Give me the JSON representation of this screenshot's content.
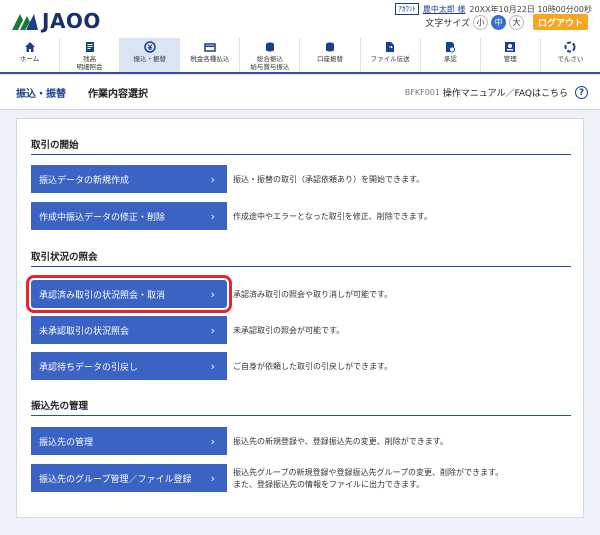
{
  "header": {
    "logo_text": "JAOO",
    "user_badge": "ｱｶｳﾝﾄ",
    "user_name": "農中太郎 様",
    "last_login": "20XX年10月22日 10時00分00秒",
    "font_size_label": "文字サイズ",
    "font_sizes": [
      "小",
      "中",
      "大"
    ],
    "logout": "ログアウト"
  },
  "nav": {
    "items": [
      {
        "label": "ホーム",
        "icon": "home-icon"
      },
      {
        "label": "残高\n明細照会",
        "icon": "document-icon"
      },
      {
        "label": "振込・振替",
        "icon": "yen-transfer-icon"
      },
      {
        "label": "税金各種払込",
        "icon": "tax-payment-icon"
      },
      {
        "label": "総合振込\n給与賞与振込",
        "icon": "coin-stack-icon"
      },
      {
        "label": "口座振替",
        "icon": "coin-stack-icon"
      },
      {
        "label": "ファイル伝送",
        "icon": "file-transfer-icon"
      },
      {
        "label": "承認",
        "icon": "approve-icon"
      },
      {
        "label": "管理",
        "icon": "admin-icon"
      },
      {
        "label": "でんさい",
        "icon": "densai-icon"
      }
    ]
  },
  "page": {
    "category": "振込・振替",
    "title": "作業内容選択",
    "code": "BFKF001",
    "help": "操作マニュアル／FAQはこちら",
    "help_icon": "?"
  },
  "sections": {
    "start": {
      "title": "取引の開始",
      "actions": [
        {
          "label": "振込データの新規作成",
          "desc": "振込・振替の取引（承認依頼あり）を開始できます。"
        },
        {
          "label": "作成中振込データの修正・削除",
          "desc": "作成途中やエラーとなった取引を修正、削除できます。"
        }
      ]
    },
    "status": {
      "title": "取引状況の照会",
      "actions": [
        {
          "label": "承認済み取引の状況照会・取消",
          "desc": "承認済み取引の照会や取り消しが可能です。"
        },
        {
          "label": "未承認取引の状況照会",
          "desc": "未承認取引の照会が可能です。"
        },
        {
          "label": "承認待ちデータの引戻し",
          "desc": "ご自身が依頼した取引の引戻しができます。"
        }
      ]
    },
    "payee": {
      "title": "振込先の管理",
      "actions": [
        {
          "label": "振込先の管理",
          "desc": "振込先の新規登録や、登録振込先の変更、削除ができます。"
        },
        {
          "label": "振込先のグループ管理／ファイル登録",
          "desc": "振込先グループの新規登録や登録振込先グループの変更、削除ができます。",
          "desc2": "また、登録振込先の情報をファイルに出力できます。"
        }
      ]
    }
  },
  "chevron": "›"
}
